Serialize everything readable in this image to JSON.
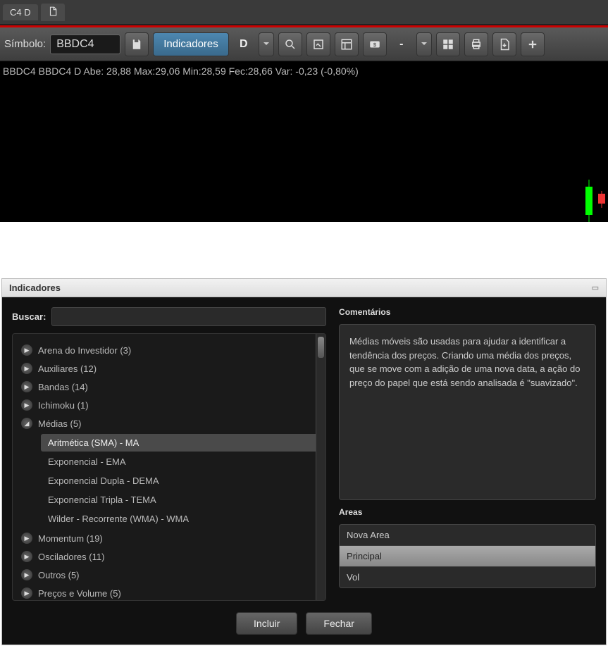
{
  "tabs": {
    "chart_tab": "C4 D"
  },
  "toolbar": {
    "symbol_label": "Símbolo:",
    "symbol_value": "BBDC4",
    "indicators_btn": "Indicadores",
    "interval": "D"
  },
  "info": "BBDC4 BBDC4 D  Abe: 28,88  Max:29,06  Min:28,59  Fec:28,66  Var: -0,23 (-0,80%)",
  "dialog": {
    "title": "Indicadores",
    "search_label": "Buscar:",
    "search_value": "",
    "categories": [
      {
        "label": "Arena do Investidor (3)",
        "expanded": false
      },
      {
        "label": "Auxiliares (12)",
        "expanded": false
      },
      {
        "label": "Bandas (14)",
        "expanded": false
      },
      {
        "label": "Ichimoku (1)",
        "expanded": false
      },
      {
        "label": "Médias (5)",
        "expanded": true,
        "children": [
          "Aritmética (SMA) - MA",
          "Exponencial - EMA",
          "Exponencial Dupla - DEMA",
          "Exponencial Tripla - TEMA",
          "Wilder - Recorrente (WMA) - WMA"
        ],
        "selected_child": 0
      },
      {
        "label": "Momentum (19)",
        "expanded": false
      },
      {
        "label": "Osciladores (11)",
        "expanded": false
      },
      {
        "label": "Outros (5)",
        "expanded": false
      },
      {
        "label": "Preços e Volume (5)",
        "expanded": false
      }
    ],
    "comments_label": "Comentários",
    "comments_text": "Médias móveis são usadas para ajudar a identificar a tendência dos preços. Criando uma média dos preços, que se move com a adição de uma nova data, a ação do preço do papel que está sendo analisada é \"suavizado\".",
    "areas_label": "Areas",
    "areas": [
      {
        "label": "Nova Area",
        "selected": false
      },
      {
        "label": "Principal",
        "selected": true
      },
      {
        "label": "Vol",
        "selected": false
      }
    ],
    "include_btn": "Incluir",
    "close_btn": "Fechar"
  }
}
